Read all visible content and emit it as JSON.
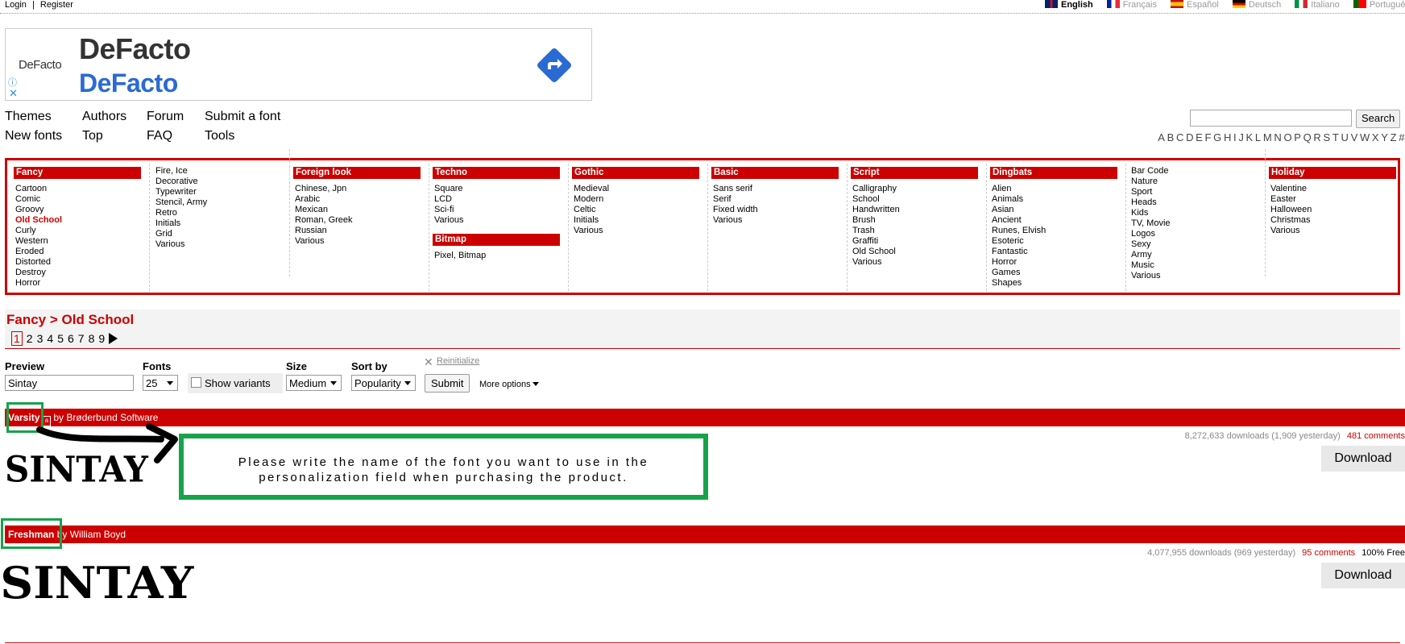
{
  "top": {
    "login": "Login",
    "separator": "|",
    "register": "Register",
    "languages": [
      {
        "label": "English",
        "active": true,
        "flag_colors": [
          "#012169",
          "#c8102e"
        ]
      },
      {
        "label": "Français",
        "active": false,
        "flag_colors": [
          "#002395",
          "#ed2939"
        ]
      },
      {
        "label": "Español",
        "active": false,
        "flag_colors": [
          "#c60b1e",
          "#ffc400"
        ]
      },
      {
        "label": "Deutsch",
        "active": false,
        "flag_colors": [
          "#000000",
          "#dd0000"
        ]
      },
      {
        "label": "Italiano",
        "active": false,
        "flag_colors": [
          "#009246",
          "#ce2b37"
        ]
      },
      {
        "label": "Português",
        "active": false,
        "flag_colors": [
          "#006600",
          "#ff0000"
        ]
      }
    ]
  },
  "ad": {
    "logo_small": "DeFacto",
    "title": "DeFacto",
    "subtitle": "DeFacto",
    "info": "ⓘ",
    "close": "✕",
    "accent": "#2a6ad3"
  },
  "nav": {
    "row1": [
      "Themes",
      "Authors",
      "Forum",
      "Submit a font"
    ],
    "row2": [
      "New fonts",
      "Top",
      "FAQ",
      "Tools"
    ],
    "search_button": "Search",
    "alphabet": [
      "A",
      "B",
      "C",
      "D",
      "E",
      "F",
      "G",
      "H",
      "I",
      "J",
      "K",
      "L",
      "M",
      "N",
      "O",
      "P",
      "Q",
      "R",
      "S",
      "T",
      "U",
      "V",
      "W",
      "X",
      "Y",
      "Z",
      "#"
    ]
  },
  "categories": {
    "fancy": {
      "title": "Fancy",
      "items": [
        "Cartoon",
        "Comic",
        "Groovy",
        "Old School",
        "Curly",
        "Western",
        "Eroded",
        "Distorted",
        "Destroy",
        "Horror"
      ],
      "active": "Old School"
    },
    "fancy2": {
      "items": [
        "Fire, Ice",
        "Decorative",
        "Typewriter",
        "Stencil, Army",
        "Retro",
        "Initials",
        "Grid",
        "Various"
      ]
    },
    "foreign": {
      "title": "Foreign look",
      "items": [
        "Chinese, Jpn",
        "Arabic",
        "Mexican",
        "Roman, Greek",
        "Russian",
        "Various"
      ]
    },
    "techno": {
      "title": "Techno",
      "items": [
        "Square",
        "LCD",
        "Sci-fi",
        "Various"
      ]
    },
    "bitmap": {
      "title": "Bitmap",
      "items": [
        "Pixel, Bitmap"
      ]
    },
    "gothic": {
      "title": "Gothic",
      "items": [
        "Medieval",
        "Modern",
        "Celtic",
        "Initials",
        "Various"
      ]
    },
    "basic": {
      "title": "Basic",
      "items": [
        "Sans serif",
        "Serif",
        "Fixed width",
        "Various"
      ]
    },
    "script": {
      "title": "Script",
      "items": [
        "Calligraphy",
        "School",
        "Handwritten",
        "Brush",
        "Trash",
        "Graffiti",
        "Old School",
        "Various"
      ]
    },
    "dingbats": {
      "title": "Dingbats",
      "items": [
        "Alien",
        "Animals",
        "Asian",
        "Ancient",
        "Runes, Elvish",
        "Esoteric",
        "Fantastic",
        "Horror",
        "Games",
        "Shapes"
      ]
    },
    "dingbats2": {
      "items": [
        "Bar Code",
        "Nature",
        "Sport",
        "Heads",
        "Kids",
        "TV, Movie",
        "Logos",
        "Sexy",
        "Army",
        "Music",
        "Various"
      ]
    },
    "holiday": {
      "title": "Holiday",
      "items": [
        "Valentine",
        "Easter",
        "Halloween",
        "Christmas",
        "Various"
      ]
    }
  },
  "breadcrumb": "Fancy > Old School",
  "pages": [
    "1",
    "2",
    "3",
    "4",
    "5",
    "6",
    "7",
    "8",
    "9"
  ],
  "form": {
    "preview_label": "Preview",
    "preview_value": "Sintay",
    "fonts_label": "Fonts",
    "fonts_value": "25",
    "show_variants": "Show variants",
    "size_label": "Size",
    "size_value": "Medium",
    "sort_label": "Sort by",
    "sort_value": "Popularity",
    "submit": "Submit",
    "reinitialize": "Reinitialize",
    "more_options": "More options"
  },
  "fonts": [
    {
      "name": "Varsity",
      "author": "by Brøderbund Software",
      "downloads": "8,272,633 downloads (1,909 yesterday)",
      "comments": "481 comments",
      "license": "",
      "download": "Download",
      "preview": "SINTAY"
    },
    {
      "name": "Freshman",
      "author": "by William Boyd",
      "downloads": "4,077,955 downloads (969 yesterday)",
      "comments": "95 comments",
      "license": "100% Free",
      "download": "Download",
      "preview": "SINTAY"
    }
  ],
  "annotation": {
    "line1": "Please write the name of the font you want to use in the",
    "line2": "personalization field when purchasing the product.",
    "color": "#17a34a"
  }
}
